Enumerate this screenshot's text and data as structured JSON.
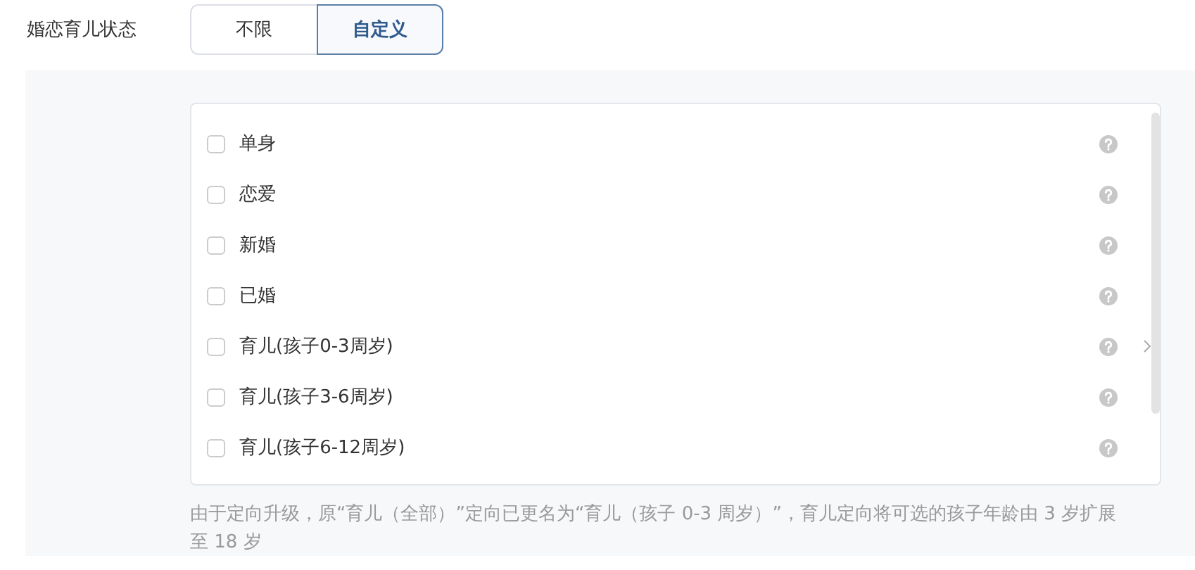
{
  "field_label": "婚恋育儿状态",
  "tabs": [
    {
      "label": "不限",
      "selected": false
    },
    {
      "label": "自定义",
      "selected": true
    }
  ],
  "options": [
    {
      "label": "单身",
      "checked": false,
      "expandable": false
    },
    {
      "label": "恋爱",
      "checked": false,
      "expandable": false
    },
    {
      "label": "新婚",
      "checked": false,
      "expandable": false
    },
    {
      "label": "已婚",
      "checked": false,
      "expandable": false
    },
    {
      "label": "育儿(孩子0-3周岁)",
      "checked": false,
      "expandable": true
    },
    {
      "label": "育儿(孩子3-6周岁)",
      "checked": false,
      "expandable": false
    },
    {
      "label": "育儿(孩子6-12周岁)",
      "checked": false,
      "expandable": false
    }
  ],
  "note": "由于定向升级，原“育儿（全部）”定向已更名为“育儿（孩子 0-3 周岁）”，育儿定向将可选的孩子年龄由 3 岁扩展至 18 岁"
}
